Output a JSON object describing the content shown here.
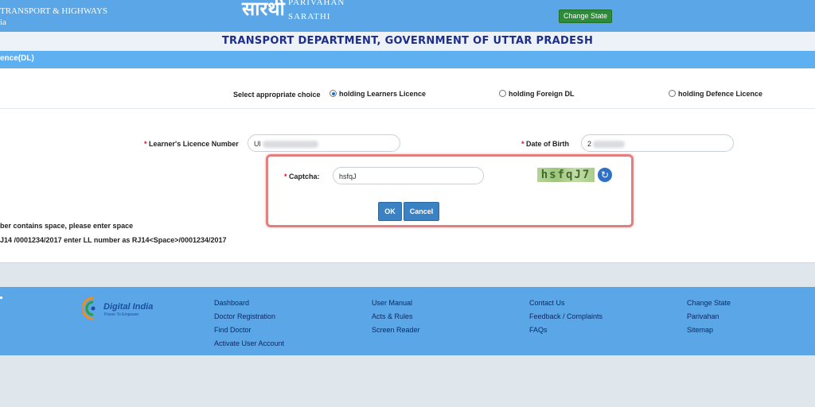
{
  "header": {
    "ministry_line1": "TRANSPORT & HIGHWAYS",
    "ministry_line2": "ia",
    "logo_hindi": "सारथी",
    "logo_line1": "PARIVAHAN",
    "logo_line2": "SARATHI",
    "change_state_label": "Change State",
    "dept_title": "TRANSPORT DEPARTMENT, GOVERNMENT OF UTTAR PRADESH"
  },
  "section": {
    "title": "ence(DL)"
  },
  "choice": {
    "label": "Select appropriate choice",
    "options": [
      {
        "label": "holding Learners Licence",
        "checked": true
      },
      {
        "label": "holding Foreign DL",
        "checked": false
      },
      {
        "label": "holding Defence Licence",
        "checked": false
      }
    ]
  },
  "form": {
    "ll_label": "Learner's Licence Number",
    "ll_value": "Ul",
    "dob_label": "Date of Birth",
    "dob_value": "2",
    "required_mark": "*"
  },
  "captcha": {
    "label": "Captcha:",
    "value": "hsfqJ",
    "image_text": "hsfqJ7",
    "ok_label": "OK",
    "cancel_label": "Cancel"
  },
  "notes": {
    "line1": "ber contains space, please enter space",
    "line2": "J14 /0001234/2017 enter LL number as RJ14<Space>/0001234/2017"
  },
  "footer": {
    "logo_text": "Digital India",
    "logo_sub": "Power To Empower",
    "col1": [
      "Dashboard",
      "Doctor Registration",
      "Find Doctor",
      "Activate User Account"
    ],
    "col2": [
      "User Manual",
      "Acts & Rules",
      "Screen Reader"
    ],
    "col3": [
      "Contact Us",
      "Feedback / Complaints",
      "FAQs"
    ],
    "col4": [
      "Change State",
      "Parivahan",
      "Sitemap"
    ]
  },
  "colors": {
    "header_blue": "#5aa6e6",
    "dept_title": "#1d2d8c",
    "highlight_border": "#e08080",
    "button_blue": "#3b82c4",
    "change_state_green": "#2e8b3a"
  },
  "icons": {
    "refresh": "refresh-icon",
    "digital_india": "digital-india-logo"
  }
}
